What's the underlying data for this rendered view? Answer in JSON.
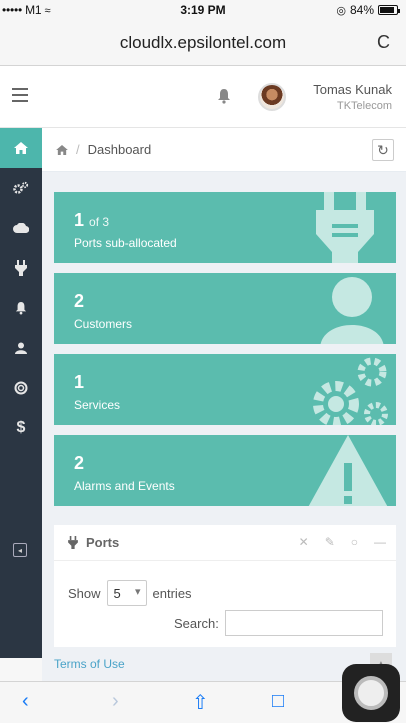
{
  "status_bar": {
    "carrier": "••••• M1",
    "wifi": " wifi",
    "time": "3:19 PM",
    "battery": "84%"
  },
  "browser": {
    "url": "cloudlx.epsilontel.com",
    "reload_glyph": "C"
  },
  "header": {
    "user_name": "Tomas Kunak",
    "user_org": "TKTelecom"
  },
  "breadcrumb": {
    "home_glyph": "#",
    "sep": "/",
    "current": "Dashboard"
  },
  "tiles": [
    {
      "number": "1",
      "suffix": "of 3",
      "label": "Ports sub-allocated",
      "icon": "plug-icon"
    },
    {
      "number": "2",
      "suffix": "",
      "label": "Customers",
      "icon": "user-icon"
    },
    {
      "number": "1",
      "suffix": "",
      "label": "Services",
      "icon": "gears-icon"
    },
    {
      "number": "2",
      "suffix": "",
      "label": "Alarms and Events",
      "icon": "warning-icon"
    }
  ],
  "ports": {
    "title": "Ports",
    "show_label": "Show",
    "entries_value": "5",
    "entries_label": "entries",
    "search_label": "Search:",
    "search_value": ""
  },
  "footer": {
    "terms": "Terms of Use"
  },
  "colors": {
    "tile": "#5bbcae",
    "sidebar": "#2b3643",
    "accent": "#4db6ac"
  }
}
